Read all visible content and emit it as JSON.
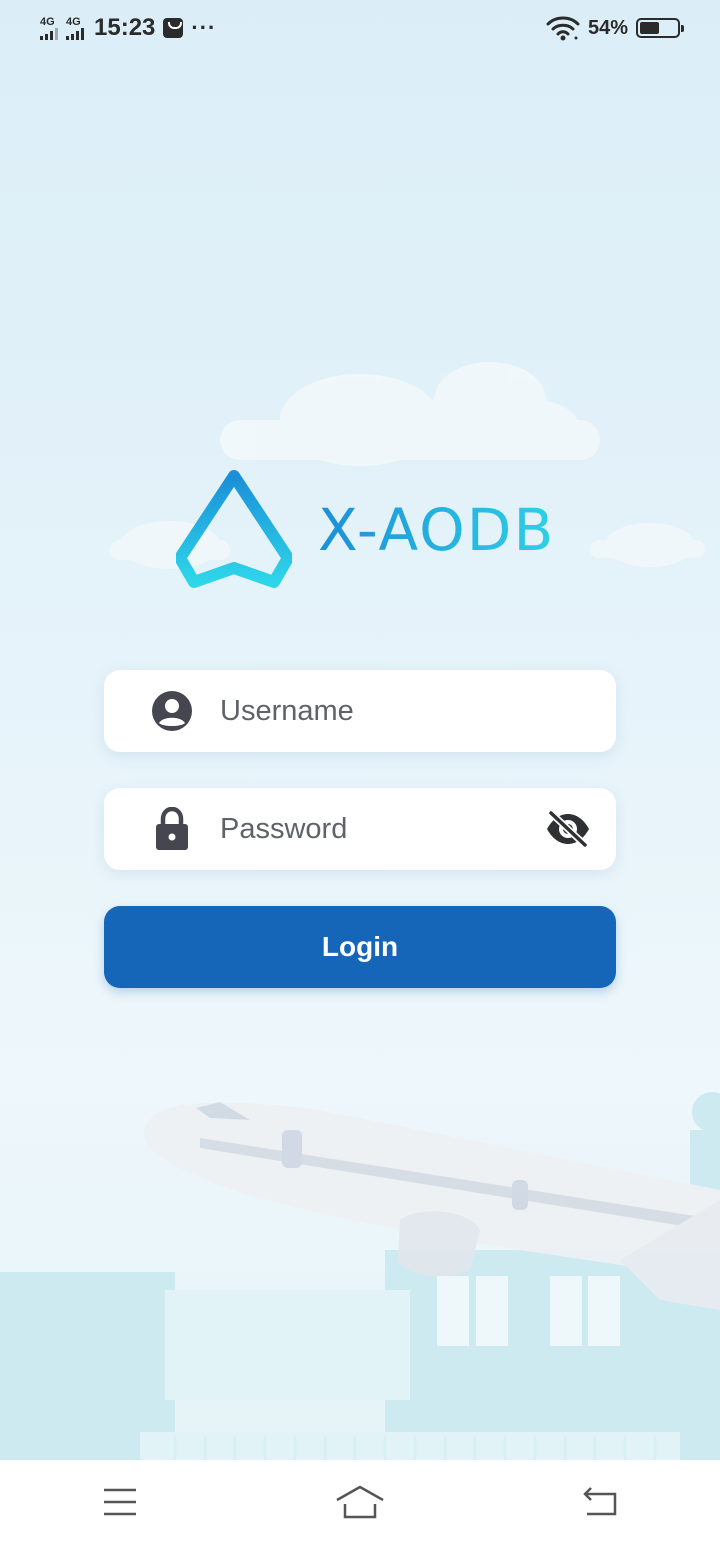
{
  "status_bar": {
    "network_1": "4G",
    "network_2": "4G",
    "time": "15:23",
    "overflow": "···",
    "battery_percent": "54%",
    "battery_level": 0.54,
    "icons": [
      "signal-icon",
      "signal-icon",
      "shopping-bag-icon",
      "wifi-icon",
      "battery-icon"
    ]
  },
  "logo": {
    "text": "X-AODB",
    "icon": "paper-plane-logo-icon"
  },
  "form": {
    "username_placeholder": "Username",
    "password_placeholder": "Password",
    "username_value": "",
    "password_value": "",
    "login_label": "Login",
    "icons": {
      "username": "account-circle-icon",
      "password": "lock-icon",
      "visibility": "visibility-off-icon"
    }
  },
  "nav_bar": {
    "icons": [
      "menu-icon",
      "home-icon",
      "back-icon"
    ]
  },
  "colors": {
    "primary_button": "#1565b8",
    "logo_gradient_start": "#1b8fd8",
    "logo_gradient_end": "#2fd0e6",
    "background": "#e6f3fa"
  }
}
